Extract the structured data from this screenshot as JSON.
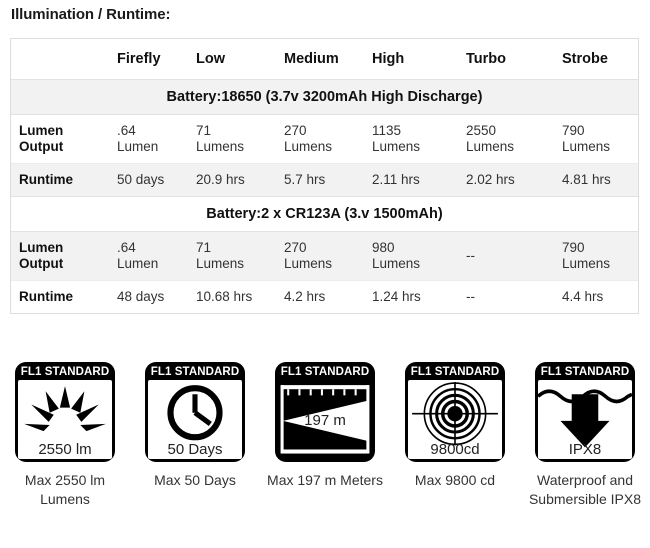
{
  "heading": "Illumination / Runtime:",
  "table": {
    "columns": [
      "",
      "Firefly",
      "Low",
      "Medium",
      "High",
      "Turbo",
      "Strobe"
    ],
    "sections": [
      {
        "battery_label": "Battery:18650 (3.7v 3200mAh High Discharge)",
        "rows": [
          {
            "label": "Lumen Output",
            "label_line1": "Lumen",
            "label_line2": "Output",
            "cells": [
              {
                "num": ".64",
                "unit": "Lumen"
              },
              {
                "num": "71",
                "unit": "Lumens"
              },
              {
                "num": "270",
                "unit": "Lumens"
              },
              {
                "num": "1135",
                "unit": "Lumens"
              },
              {
                "num": "2550",
                "unit": "Lumens"
              },
              {
                "num": "790",
                "unit": "Lumens"
              }
            ]
          },
          {
            "label": "Runtime",
            "cells": [
              {
                "num": "50 days",
                "unit": ""
              },
              {
                "num": "20.9 hrs",
                "unit": ""
              },
              {
                "num": "5.7 hrs",
                "unit": ""
              },
              {
                "num": "2.11 hrs",
                "unit": ""
              },
              {
                "num": "2.02 hrs",
                "unit": ""
              },
              {
                "num": "4.81 hrs",
                "unit": ""
              }
            ]
          }
        ]
      },
      {
        "battery_label": "Battery:2 x CR123A (3.v 1500mAh)",
        "rows": [
          {
            "label": "Lumen Output",
            "label_line1": "Lumen",
            "label_line2": "Output",
            "cells": [
              {
                "num": ".64",
                "unit": "Lumen"
              },
              {
                "num": "71",
                "unit": "Lumens"
              },
              {
                "num": "270",
                "unit": "Lumens"
              },
              {
                "num": "980",
                "unit": "Lumens"
              },
              {
                "num": "--",
                "unit": ""
              },
              {
                "num": "790",
                "unit": "Lumens"
              }
            ]
          },
          {
            "label": "Runtime",
            "cells": [
              {
                "num": "48 days",
                "unit": ""
              },
              {
                "num": "10.68 hrs",
                "unit": ""
              },
              {
                "num": "4.2 hrs",
                "unit": ""
              },
              {
                "num": "1.24 hrs",
                "unit": ""
              },
              {
                "num": "--",
                "unit": ""
              },
              {
                "num": "4.4 hrs",
                "unit": ""
              }
            ]
          }
        ]
      }
    ]
  },
  "fl1_badges": [
    {
      "standard": "FL1 STANDARD",
      "icon": "sunburst-icon",
      "value": "2550 lm",
      "caption": "Max 2550 lm Lumens"
    },
    {
      "standard": "FL1 STANDARD",
      "icon": "clock-icon",
      "value": "50 Days",
      "caption": "Max 50 Days"
    },
    {
      "standard": "FL1 STANDARD",
      "icon": "beam-distance-icon",
      "value": "197 m",
      "caption": "Max 197 m Meters"
    },
    {
      "standard": "FL1 STANDARD",
      "icon": "candela-target-icon",
      "value": "9800cd",
      "caption": "Max 9800 cd"
    },
    {
      "standard": "FL1 STANDARD",
      "icon": "water-immersion-icon",
      "value": "IPX8",
      "caption": "Waterproof and Submersible IPX8"
    }
  ],
  "colors": {
    "badge_black": "#000000",
    "row_shade": "#f2f2f2",
    "table_border": "#dddddd",
    "text": "#333333"
  }
}
